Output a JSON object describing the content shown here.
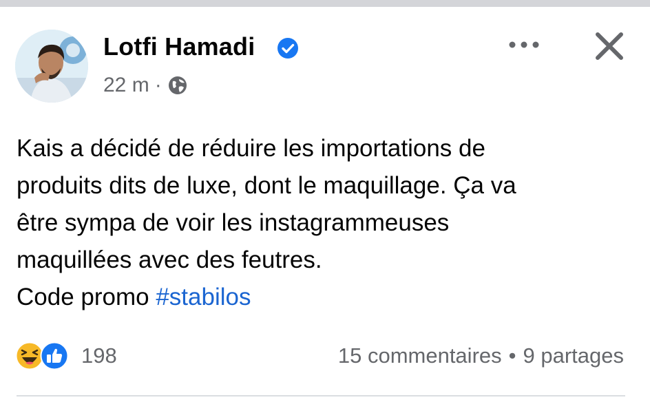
{
  "post": {
    "author": {
      "name": "Lotfi Hamadi",
      "verified": true,
      "avatar_icon": "profile-photo"
    },
    "timestamp": "22 m",
    "separator": "·",
    "privacy_icon": "globe-icon",
    "text_lines": [
      "Kais a décidé de réduire les importations de",
      "produits dits de luxe, dont le maquillage. Ça va",
      "être sympa de voir les instagrammeuses",
      "maquillées avec des feutres."
    ],
    "promo_prefix": "Code promo ",
    "hashtag": "#stabilos",
    "reactions": {
      "icons": [
        "haha-icon",
        "like-icon"
      ],
      "count": "198"
    },
    "comments": "15 commentaires",
    "stats_separator": "•",
    "shares": "9 partages"
  },
  "actions": {
    "more_icon": "more-options-icon",
    "close_icon": "close-icon"
  },
  "colors": {
    "text": "#050505",
    "secondary_text": "#65676b",
    "link": "#1b65d1",
    "verified_badge": "#1877f2",
    "like_blue": "#1877f2",
    "haha_yellow": "#f7b928",
    "top_bar": "#d4d5d9",
    "divider": "#dadde1"
  }
}
